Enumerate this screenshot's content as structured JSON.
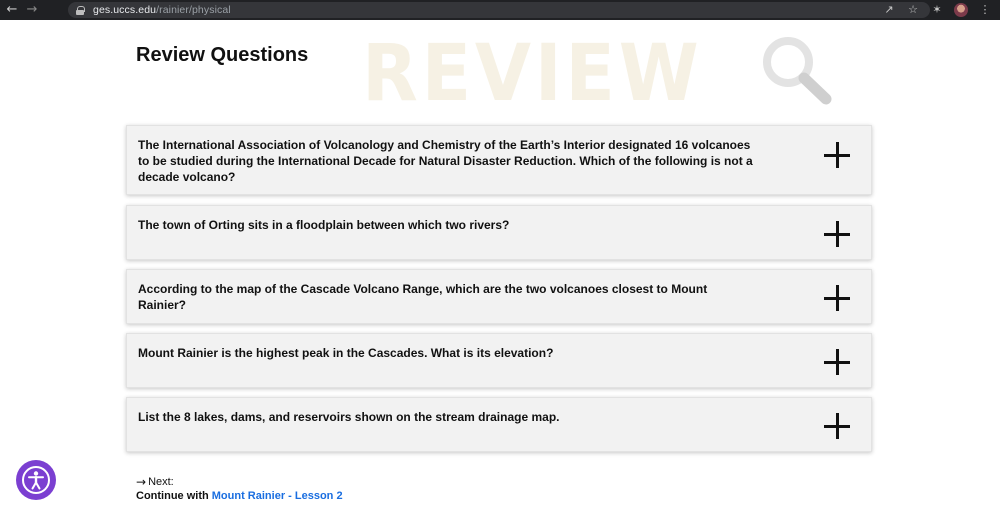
{
  "browser": {
    "url_host": "ges.uccs.edu",
    "url_path": "/rainier/physical",
    "icons": [
      "back-arrow-icon",
      "forward-arrow-icon",
      "lock-icon",
      "share-icon",
      "star-icon",
      "extensions-icon",
      "profile-avatar",
      "more-vert-icon"
    ]
  },
  "page": {
    "title": "Review Questions",
    "watermark": "REVIEW"
  },
  "questions": [
    "The International Association of Volcanology and Chemistry of the Earth’s Interior designated 16 volcanoes to be studied during the International Decade for Natural Disaster Reduction. Which of the following is not a decade volcano?",
    "The town of Orting sits in a floodplain between which two rivers?",
    "According to the map of the Cascade Volcano Range, which are the two volcanoes closest to Mount Rainier?",
    "Mount Rainier is the highest peak in the Cascades. What is its elevation?",
    "List the 8 lakes, dams, and reservoirs shown on the stream drainage map."
  ],
  "footer_nav": {
    "next_label": "Next:",
    "continue_text": "Continue with ",
    "continue_link": "Mount Rainier - Lesson 2"
  },
  "colors": {
    "accent_link": "#1a6ee0",
    "accessibility_button": "#7b3fd1",
    "watermark": "#f6f1e4",
    "card_bg": "#f2f2f2"
  }
}
